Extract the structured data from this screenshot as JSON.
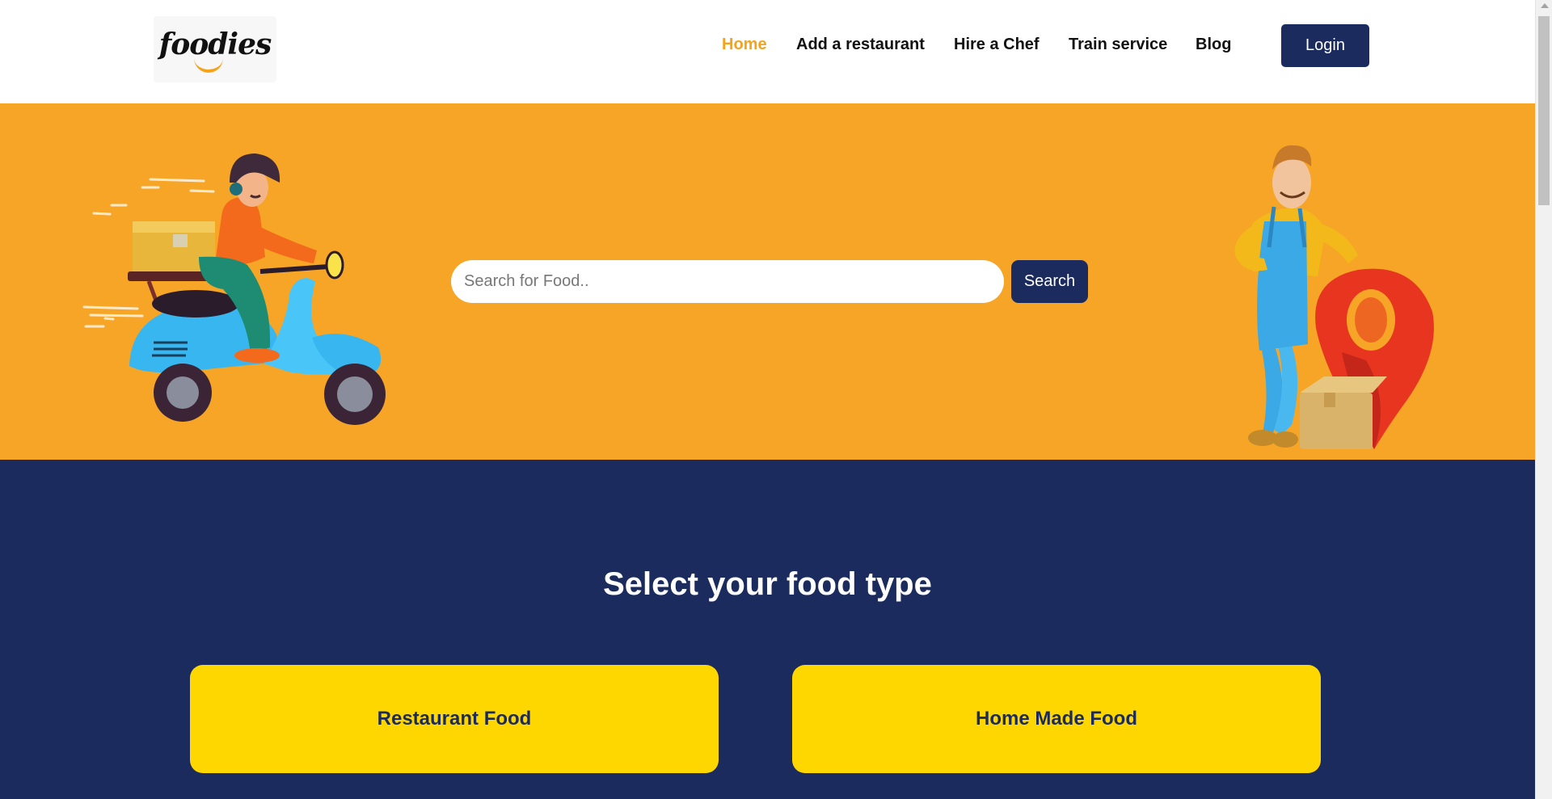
{
  "brand": {
    "logo_text": "foodies",
    "logo_icon": "smile-icon",
    "accent_color": "#f5a31a"
  },
  "nav": {
    "items": [
      {
        "label": "Home",
        "active": true
      },
      {
        "label": "Add a restaurant",
        "active": false
      },
      {
        "label": "Hire a Chef",
        "active": false
      },
      {
        "label": "Train service",
        "active": false
      },
      {
        "label": "Blog",
        "active": false
      }
    ],
    "login_label": "Login"
  },
  "hero": {
    "search_placeholder": "Search for Food..",
    "search_button": "Search",
    "background_color": "#f7a526",
    "left_illustration": "delivery-scooter-illustration",
    "right_illustration": "courier-location-pin-illustration"
  },
  "food_type": {
    "title": "Select your food type",
    "cards": [
      {
        "label": "Restaurant Food"
      },
      {
        "label": "Home Made Food"
      }
    ],
    "background_color": "#1b2b5e",
    "card_color": "#ffd700"
  }
}
